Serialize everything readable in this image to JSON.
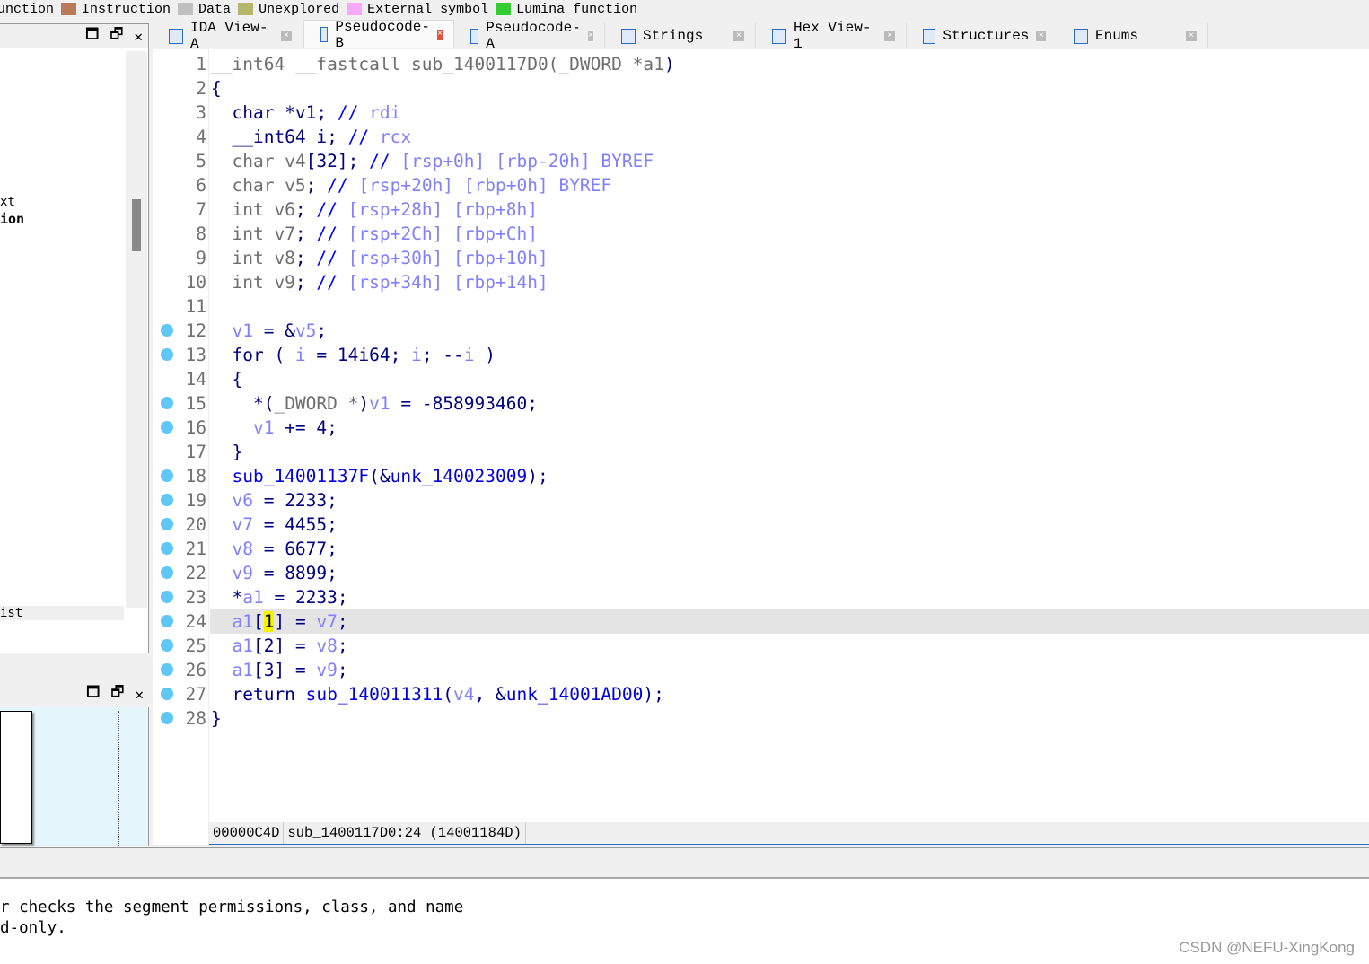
{
  "legend": [
    {
      "label": "function",
      "color": ""
    },
    {
      "label": "Instruction",
      "color": "#b97b59"
    },
    {
      "label": "Data",
      "color": "#c0c0c0"
    },
    {
      "label": "Unexplored",
      "color": "#b5b56b"
    },
    {
      "label": "External symbol",
      "color": "#f7a8f7"
    },
    {
      "label": "Lumina function",
      "color": "#33cc33"
    }
  ],
  "left_panel": {
    "frag1": "xt",
    "frag2": "ion",
    "frag3": "ist"
  },
  "tabs": [
    {
      "label": "IDA View-A",
      "icon": "ida"
    },
    {
      "label": "Pseudocode-B",
      "icon": "pc",
      "active": true
    },
    {
      "label": "Pseudocode-A",
      "icon": "pc"
    },
    {
      "label": "Strings",
      "icon": "s"
    },
    {
      "label": "Hex View-1",
      "icon": "o"
    },
    {
      "label": "Structures",
      "icon": "A"
    },
    {
      "label": "Enums",
      "icon": "E"
    }
  ],
  "code": [
    {
      "bp": false,
      "t": [
        [
          "__int64 __fastcall sub_1400117D0(_DWORD *a1",
          "g"
        ],
        [
          ")",
          "n"
        ]
      ]
    },
    {
      "bp": false,
      "t": [
        [
          "{",
          "n"
        ]
      ]
    },
    {
      "bp": false,
      "t": [
        [
          "  char *v1; ",
          "n"
        ],
        [
          "// ",
          "c"
        ],
        [
          "rdi",
          "v"
        ]
      ]
    },
    {
      "bp": false,
      "t": [
        [
          "  __int64 i; ",
          "n"
        ],
        [
          "// ",
          "c"
        ],
        [
          "rcx",
          "v"
        ]
      ]
    },
    {
      "bp": false,
      "t": [
        [
          "  char v4",
          "g"
        ],
        [
          "[32]; ",
          "n"
        ],
        [
          "// ",
          "c"
        ],
        [
          "[rsp+0h] [rbp-20h] BYREF",
          "v"
        ]
      ]
    },
    {
      "bp": false,
      "t": [
        [
          "  char v5",
          "g"
        ],
        [
          "; ",
          "n"
        ],
        [
          "// ",
          "c"
        ],
        [
          "[rsp+20h] [rbp+0h] BYREF",
          "v"
        ]
      ]
    },
    {
      "bp": false,
      "t": [
        [
          "  int v6",
          "g"
        ],
        [
          "; ",
          "n"
        ],
        [
          "// ",
          "c"
        ],
        [
          "[rsp+28h] [rbp+8h]",
          "v"
        ]
      ]
    },
    {
      "bp": false,
      "t": [
        [
          "  int v7",
          "g"
        ],
        [
          "; ",
          "n"
        ],
        [
          "// ",
          "c"
        ],
        [
          "[rsp+2Ch] [rbp+Ch]",
          "v"
        ]
      ]
    },
    {
      "bp": false,
      "t": [
        [
          "  int v8",
          "g"
        ],
        [
          "; ",
          "n"
        ],
        [
          "// ",
          "c"
        ],
        [
          "[rsp+30h] [rbp+10h]",
          "v"
        ]
      ]
    },
    {
      "bp": false,
      "t": [
        [
          "  int v9",
          "g"
        ],
        [
          "; ",
          "n"
        ],
        [
          "// ",
          "c"
        ],
        [
          "[rsp+34h] [rbp+14h]",
          "v"
        ]
      ]
    },
    {
      "bp": false,
      "t": []
    },
    {
      "bp": true,
      "t": [
        [
          "  ",
          "n"
        ],
        [
          "v1",
          "v"
        ],
        [
          " = &",
          "n"
        ],
        [
          "v5",
          "v"
        ],
        [
          ";",
          "n"
        ]
      ]
    },
    {
      "bp": true,
      "t": [
        [
          "  for ( ",
          "n"
        ],
        [
          "i",
          "v"
        ],
        [
          " = 14i64; ",
          "n"
        ],
        [
          "i",
          "v"
        ],
        [
          "; --",
          "n"
        ],
        [
          "i",
          "v"
        ],
        [
          " )",
          "n"
        ]
      ]
    },
    {
      "bp": false,
      "t": [
        [
          "  {",
          "n"
        ]
      ]
    },
    {
      "bp": true,
      "t": [
        [
          "    *(",
          "n"
        ],
        [
          "_DWORD *",
          "g"
        ],
        [
          ")",
          "n"
        ],
        [
          "v1",
          "v"
        ],
        [
          " = -858993460;",
          "n"
        ]
      ]
    },
    {
      "bp": true,
      "t": [
        [
          "    ",
          "n"
        ],
        [
          "v1",
          "v"
        ],
        [
          " += 4;",
          "n"
        ]
      ]
    },
    {
      "bp": false,
      "t": [
        [
          "  }",
          "n"
        ]
      ]
    },
    {
      "bp": true,
      "t": [
        [
          "  ",
          "n"
        ],
        [
          "sub_14001137F",
          "f"
        ],
        [
          "(&",
          "n"
        ],
        [
          "unk_140023009",
          "f"
        ],
        [
          ");",
          "n"
        ]
      ]
    },
    {
      "bp": true,
      "t": [
        [
          "  ",
          "n"
        ],
        [
          "v6",
          "v"
        ],
        [
          " = 2233;",
          "n"
        ]
      ]
    },
    {
      "bp": true,
      "t": [
        [
          "  ",
          "n"
        ],
        [
          "v7",
          "v"
        ],
        [
          " = 4455;",
          "n"
        ]
      ]
    },
    {
      "bp": true,
      "t": [
        [
          "  ",
          "n"
        ],
        [
          "v8",
          "v"
        ],
        [
          " = 6677;",
          "n"
        ]
      ]
    },
    {
      "bp": true,
      "t": [
        [
          "  ",
          "n"
        ],
        [
          "v9",
          "v"
        ],
        [
          " = 8899;",
          "n"
        ]
      ]
    },
    {
      "bp": true,
      "t": [
        [
          "  *",
          "n"
        ],
        [
          "a1",
          "v"
        ],
        [
          " = 2233;",
          "n"
        ]
      ]
    },
    {
      "bp": true,
      "hl": true,
      "t": [
        [
          "  ",
          "n"
        ],
        [
          "a1",
          "v"
        ],
        [
          "[",
          "n"
        ],
        [
          "1",
          "cur"
        ],
        [
          "] = ",
          "n"
        ],
        [
          "v7",
          "v"
        ],
        [
          ";",
          "n"
        ]
      ]
    },
    {
      "bp": true,
      "t": [
        [
          "  ",
          "n"
        ],
        [
          "a1",
          "v"
        ],
        [
          "[2] = ",
          "n"
        ],
        [
          "v8",
          "v"
        ],
        [
          ";",
          "n"
        ]
      ]
    },
    {
      "bp": true,
      "t": [
        [
          "  ",
          "n"
        ],
        [
          "a1",
          "v"
        ],
        [
          "[3] = ",
          "n"
        ],
        [
          "v9",
          "v"
        ],
        [
          ";",
          "n"
        ]
      ]
    },
    {
      "bp": true,
      "t": [
        [
          "  return ",
          "n"
        ],
        [
          "sub_140011311",
          "f"
        ],
        [
          "(",
          "n"
        ],
        [
          "v4",
          "v"
        ],
        [
          ", &",
          "n"
        ],
        [
          "unk_14001AD00",
          "f"
        ],
        [
          ");",
          "n"
        ]
      ]
    },
    {
      "bp": true,
      "t": [
        [
          "}",
          "n"
        ]
      ]
    }
  ],
  "status": {
    "offset": "00000C4D",
    "location": "sub_1400117D0:24 (14001184D)"
  },
  "output": {
    "lines": [
      "r checks the segment permissions, class, and name",
      "d-only."
    ]
  },
  "watermark": "CSDN @NEFU-XingKong"
}
